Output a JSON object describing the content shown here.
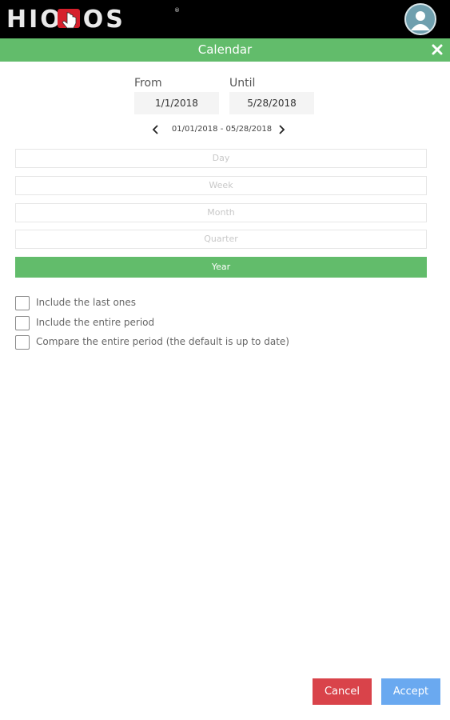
{
  "header": {
    "logo_text": "HIOPOS",
    "avatar_icon": "user-icon"
  },
  "dialog": {
    "title": "Calendar",
    "close_icon": "close-icon"
  },
  "dates": {
    "from_label": "From",
    "from_value": "1/1/2018",
    "until_label": "Until",
    "until_value": "5/28/2018",
    "range_text": "01/01/2018 - 05/28/2018"
  },
  "periods": [
    {
      "label": "Day",
      "active": false
    },
    {
      "label": "Week",
      "active": false
    },
    {
      "label": "Month",
      "active": false
    },
    {
      "label": "Quarter",
      "active": false
    },
    {
      "label": "Year",
      "active": true
    }
  ],
  "options": [
    {
      "label": "Include the last ones",
      "checked": false
    },
    {
      "label": "Include the entire period",
      "checked": false
    },
    {
      "label": "Compare the entire period (the default is up to date)",
      "checked": false
    }
  ],
  "buttons": {
    "cancel_label": "Cancel",
    "accept_label": "Accept"
  },
  "colors": {
    "accent_green": "#62bc6b",
    "cancel_red": "#d9434a",
    "accept_blue": "#6aa9f0",
    "logo_red": "#d6202c"
  }
}
